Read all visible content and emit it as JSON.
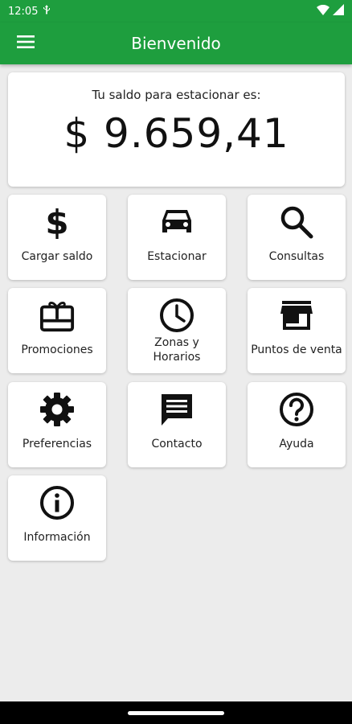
{
  "status_bar": {
    "time": "12:05"
  },
  "app_bar": {
    "title": "Bienvenido"
  },
  "balance": {
    "label": "Tu saldo para estacionar es:",
    "amount": "$ 9.659,41"
  },
  "tiles": [
    {
      "label": "Cargar saldo",
      "icon": "dollar-icon"
    },
    {
      "label": "Estacionar",
      "icon": "car-icon"
    },
    {
      "label": "Consultas",
      "icon": "search-icon"
    },
    {
      "label": "Promociones",
      "icon": "gift-card-icon"
    },
    {
      "label": "Zonas y Horarios",
      "icon": "clock-icon"
    },
    {
      "label": "Puntos de venta",
      "icon": "store-icon"
    },
    {
      "label": "Preferencias",
      "icon": "gear-icon"
    },
    {
      "label": "Contacto",
      "icon": "message-icon"
    },
    {
      "label": "Ayuda",
      "icon": "help-icon"
    },
    {
      "label": "Información",
      "icon": "info-icon"
    }
  ],
  "colors": {
    "primary": "#1e9e3e",
    "background": "#ececec"
  }
}
